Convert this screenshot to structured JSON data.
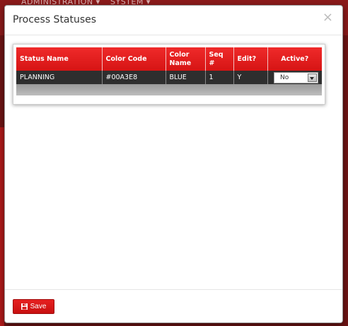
{
  "background": {
    "menu": [
      "ADMINISTRATION ▾",
      "SYSTEM ▾"
    ]
  },
  "modal": {
    "title": "Process Statuses",
    "close_glyph": "×",
    "table": {
      "headers": [
        "Status Name",
        "Color Code",
        "Color Name",
        "Seq #",
        "Edit?",
        "Active?"
      ],
      "rows": [
        {
          "status_name": "PLANNING",
          "color_code": "#00A3E8",
          "color_name": "BLUE",
          "seq": "1",
          "edit": "Y",
          "active": "No"
        }
      ]
    },
    "footer": {
      "save_label": "Save"
    }
  },
  "colors": {
    "header_red": "#e01a1a",
    "row_dark": "#2e2e2e",
    "button_red": "#d81818"
  },
  "icons": {
    "close": "close-icon",
    "save": "floppy-disk-icon",
    "dropdown": "chevron-down-icon"
  }
}
